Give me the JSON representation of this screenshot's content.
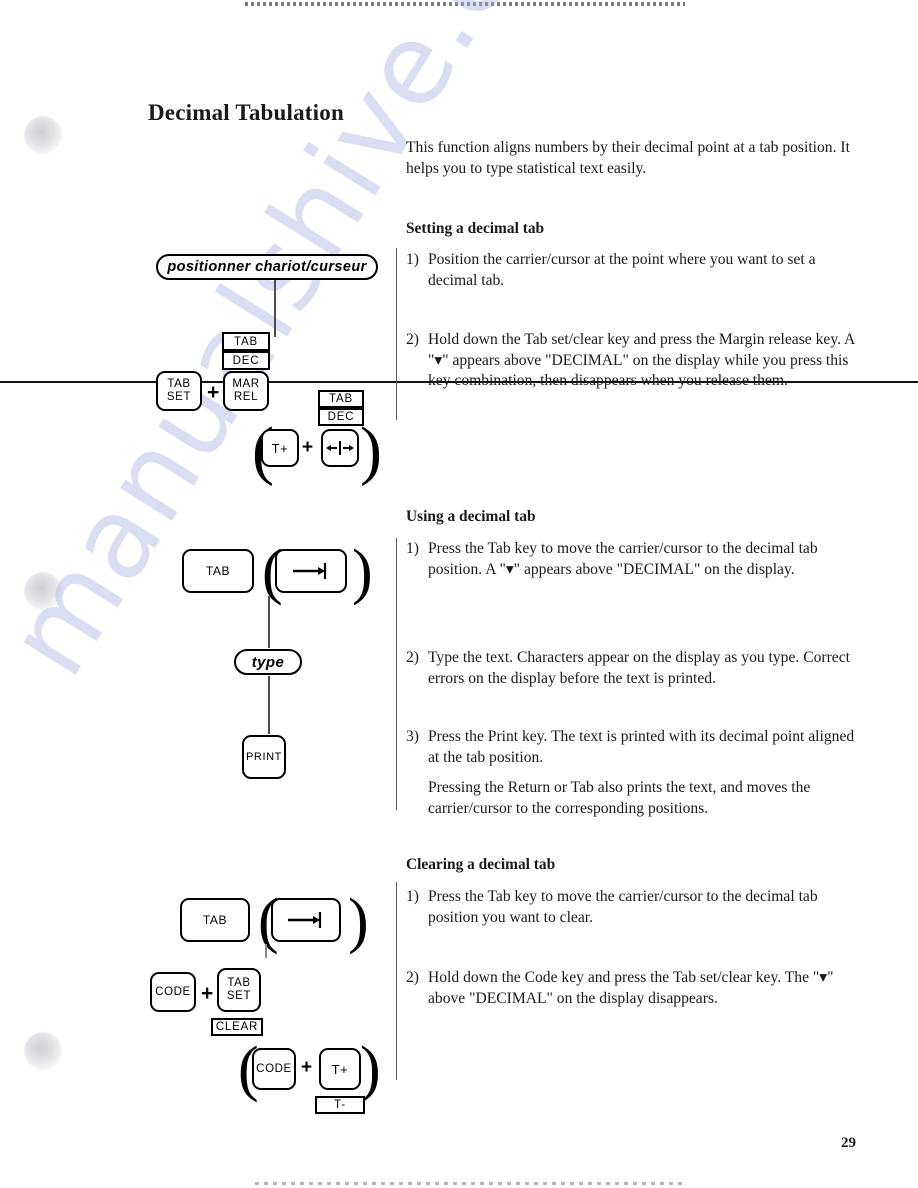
{
  "page": {
    "title": "Decimal Tabulation",
    "number": "29"
  },
  "watermark": {
    "text": "manualshive.com"
  },
  "intro": {
    "text": "This function aligns numbers by their decimal point at a tab position. It helps you to type statistical text easily."
  },
  "sections": [
    {
      "heading": "Setting a decimal tab",
      "steps": [
        {
          "marker": "1)",
          "text": "Position the carrier/cursor at the point where you want to set a decimal tab."
        },
        {
          "marker": "2)",
          "text": "Hold down the Tab set/clear key and press the Margin release key. A \"▾\" appears above \"DECIMAL\" on the display while you press this key combination, then disappears when you release them."
        }
      ]
    },
    {
      "heading": "Using a decimal tab",
      "steps": [
        {
          "marker": "1)",
          "text": "Press the Tab key to move the carrier/cursor to the decimal tab position. A \"▾\" appears above \"DECIMAL\" on the display."
        },
        {
          "marker": "2)",
          "text": "Type the text. Characters appear on the display as you type. Correct errors on the display before the text is printed."
        },
        {
          "marker": "3)",
          "text": "Press the Print key. The text is printed with its decimal point aligned at the tab position."
        }
      ],
      "note": "Pressing the Return or Tab also prints the text, and moves the carrier/cursor to the corresponding positions."
    },
    {
      "heading": "Clearing a decimal tab",
      "steps": [
        {
          "marker": "1)",
          "text": "Press the Tab key to move the carrier/cursor to the decimal tab position you want to clear."
        },
        {
          "marker": "2)",
          "text": "Hold down the Code key and press the Tab set/clear key. The \"▾\" above \"DECIMAL\" on the display disappears."
        }
      ]
    }
  ],
  "diagrams": {
    "setting": {
      "bubble": "positionner  chariot/curseur",
      "legend_tab": "TAB",
      "legend_dec": "DEC",
      "key_tab_set_line1": "TAB",
      "key_tab_set_line2": "SET",
      "key_mar_rel_line1": "MAR",
      "key_mar_rel_line2": "REL",
      "plus": "+",
      "alt_legend_tab": "TAB",
      "alt_legend_dec": "DEC",
      "alt_key_t_plus": "T+",
      "alt_plus": "+",
      "alt_key_margin_symbol": "margin-release-icon"
    },
    "using": {
      "key_tab": "TAB",
      "key_tab_symbol": "tab-arrow-icon",
      "bubble": "type",
      "key_print": "PRINT"
    },
    "clearing": {
      "key_tab": "TAB",
      "key_tab_symbol": "tab-arrow-icon",
      "key_code": "CODE",
      "plus": "+",
      "key_tab_set_line1": "TAB",
      "key_tab_set_line2": "SET",
      "legend_clear": "CLEAR",
      "alt_key_code": "CODE",
      "alt_plus": "+",
      "alt_key_t_plus": "T+",
      "alt_legend_t_minus": "T-"
    }
  }
}
